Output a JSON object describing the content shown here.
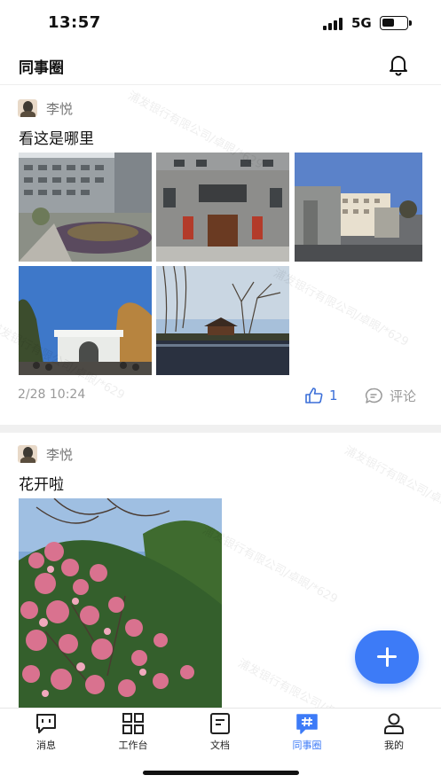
{
  "status_bar": {
    "time": "13:57",
    "network": "5G"
  },
  "header": {
    "title": "同事圈"
  },
  "posts": [
    {
      "author": "李悦",
      "text": "看这是哪里",
      "timestamp": "2/28 10:24",
      "like_count": "1",
      "comment_label": "评论"
    },
    {
      "author": "李悦",
      "text": "花开啦"
    }
  ],
  "watermark": "浦发银行有限公司/卓眼/*629",
  "tabs": [
    {
      "label": "消息",
      "icon": "message-icon"
    },
    {
      "label": "工作台",
      "icon": "grid-icon"
    },
    {
      "label": "文档",
      "icon": "document-icon"
    },
    {
      "label": "同事圈",
      "icon": "hashtag-chat-icon",
      "active": true
    },
    {
      "label": "我的",
      "icon": "person-icon"
    }
  ],
  "colors": {
    "accent": "#3d7bf7",
    "like": "#3b6fd8",
    "muted": "#999999"
  }
}
